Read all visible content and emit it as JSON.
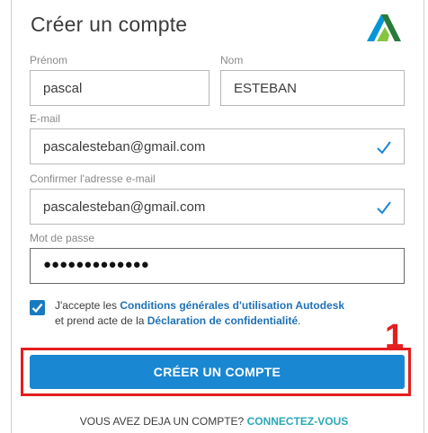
{
  "form": {
    "title": "Créer un compte",
    "first_name": {
      "label": "Prénom",
      "value": "pascal"
    },
    "last_name": {
      "label": "Nom",
      "value": "ESTEBAN"
    },
    "email": {
      "label": "E-mail",
      "value": "pascalesteban@gmail.com"
    },
    "email_confirm": {
      "label": "Confirmer l'adresse e-mail",
      "value": "pascalesteban@gmail.com"
    },
    "password": {
      "label": "Mot de passe",
      "value": "●●●●●●●●●●●●●"
    },
    "terms": {
      "checked": true,
      "text_1": "J'accepte les ",
      "link_1": "Conditions générales d'utilisation Autodesk",
      "text_2": "et prend acte de la ",
      "link_2": "Déclaration de confidentialité",
      "text_3": "."
    },
    "submit_label": "CRÉER UN COMPTE",
    "footer": {
      "text": "VOUS AVEZ DEJA UN COMPTE? ",
      "link": "CONNECTEZ-VOUS"
    }
  },
  "annotation": {
    "number": "1"
  },
  "colors": {
    "accent": "#1a87d3",
    "link": "#1f72b8",
    "annotation": "#e41e1e",
    "check": "#1a87d3"
  },
  "icons": {
    "logo": "autodesk-logo",
    "valid": "checkmark-icon"
  }
}
